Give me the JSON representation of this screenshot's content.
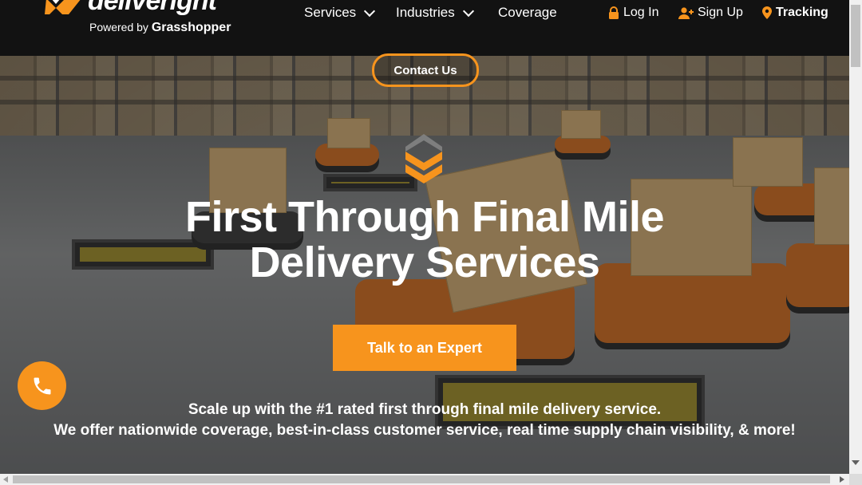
{
  "brand": {
    "name": "deliveright",
    "powered_by": "Powered by",
    "powered_brand": "Grasshopper"
  },
  "nav": {
    "services": "Services",
    "industries": "Industries",
    "coverage": "Coverage"
  },
  "utility": {
    "login": "Log In",
    "signup": "Sign Up",
    "tracking": "Tracking"
  },
  "hero": {
    "contact_label": "Contact Us",
    "title_line1": "First Through Final Mile",
    "title_line2": "Delivery Services",
    "cta_label": "Talk to an Expert",
    "tagline1": "Scale up with the #1 rated first through final mile delivery service.",
    "tagline2": "We offer nationwide coverage, best-in-class customer service, real time supply chain visibility, & more!"
  },
  "colors": {
    "accent": "#f7941d",
    "header_bg": "#121212"
  },
  "icons": [
    "lock-icon",
    "user-plus-icon",
    "map-pin-icon",
    "chevron-down-icon",
    "phone-icon",
    "brand-chevron-icon"
  ]
}
